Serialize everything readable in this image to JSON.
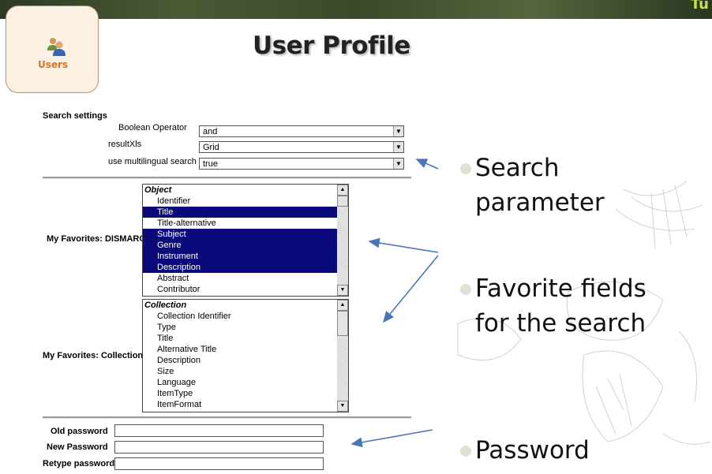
{
  "header": {
    "corner_text": "Tu"
  },
  "users_tile": {
    "label": "Users",
    "icon": "users-icon"
  },
  "page_title": "User Profile",
  "search_settings": {
    "heading": "Search settings",
    "rows": [
      {
        "label": "Boolean Operator",
        "value": "and"
      },
      {
        "label": "resultXls",
        "value": "Grid"
      },
      {
        "label": "use multilingual search",
        "value": "true"
      }
    ]
  },
  "favorites_dismarc": {
    "label": "My Favorites: DISMARC",
    "items": [
      {
        "text": "Object",
        "header": true,
        "selected": false
      },
      {
        "text": "Identifier",
        "header": false,
        "selected": false
      },
      {
        "text": "Title",
        "header": false,
        "selected": true
      },
      {
        "text": "Title-alternative",
        "header": false,
        "selected": false
      },
      {
        "text": "Subject",
        "header": false,
        "selected": true
      },
      {
        "text": "Genre",
        "header": false,
        "selected": true
      },
      {
        "text": "Instrument",
        "header": false,
        "selected": true
      },
      {
        "text": "Description",
        "header": false,
        "selected": true
      },
      {
        "text": "Abstract",
        "header": false,
        "selected": false
      },
      {
        "text": "Contributor",
        "header": false,
        "selected": false
      }
    ]
  },
  "favorites_collections": {
    "label": "My Favorites: Collections",
    "items": [
      {
        "text": "Collection",
        "header": true,
        "selected": false
      },
      {
        "text": "Collection Identifier",
        "header": false,
        "selected": false
      },
      {
        "text": "Type",
        "header": false,
        "selected": false
      },
      {
        "text": "Title",
        "header": false,
        "selected": false
      },
      {
        "text": "Alternative Title",
        "header": false,
        "selected": false
      },
      {
        "text": "Description",
        "header": false,
        "selected": false
      },
      {
        "text": "Size",
        "header": false,
        "selected": false
      },
      {
        "text": "Language",
        "header": false,
        "selected": false
      },
      {
        "text": "ItemType",
        "header": false,
        "selected": false
      },
      {
        "text": "ItemFormat",
        "header": false,
        "selected": false
      }
    ]
  },
  "password": {
    "old_label": "Old password",
    "new_label": "New Password",
    "retype_label": "Retype password",
    "old_value": "",
    "new_value": "",
    "retype_value": ""
  },
  "bullets": {
    "search_line1": "Search",
    "search_line2": "parameter",
    "favorite_line1": "Favorite fields",
    "favorite_line2": "for the search",
    "password": "Password"
  },
  "colors": {
    "selection": "#0a0a7a",
    "arrow": "#4a76b8",
    "tile_border": "#c48c6a",
    "tile_label": "#d4742a",
    "corner_text": "#c8e04a"
  }
}
